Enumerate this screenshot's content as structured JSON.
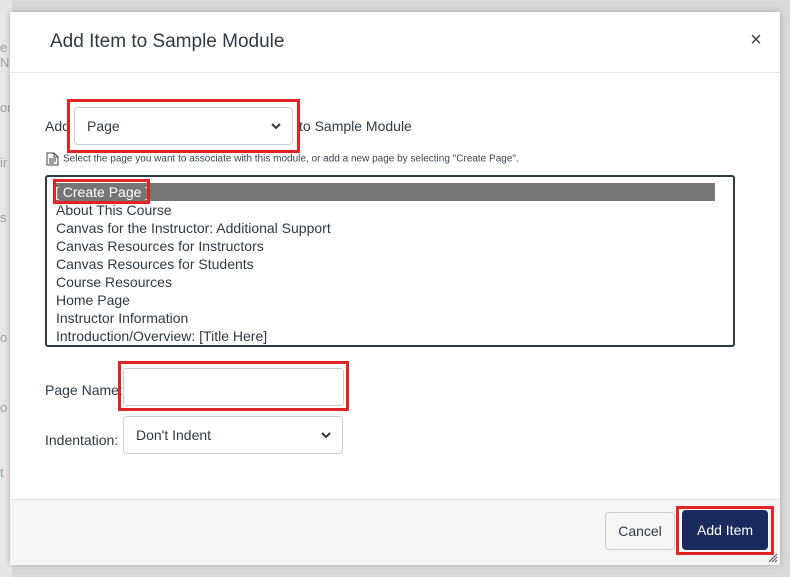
{
  "dialog": {
    "title": "Add Item to Sample Module",
    "close_label": "×"
  },
  "add_row": {
    "prefix": "Add",
    "type_select": {
      "selected": "Page"
    },
    "suffix": "to Sample Module"
  },
  "hint": "Select the page you want to associate with this module, or add a new page by selecting \"Create Page\".",
  "page_list": {
    "items": [
      "[ Create Page ]",
      "About This Course",
      "Canvas for the Instructor: Additional Support",
      "Canvas Resources for Instructors",
      "Canvas Resources for Students",
      "Course Resources",
      "Home Page",
      "Instructor Information",
      "Introduction/Overview: [Title Here]"
    ],
    "selected_index": 0
  },
  "page_name": {
    "label": "Page Name:",
    "value": ""
  },
  "indentation": {
    "label": "Indentation:",
    "selected": "Don't Indent"
  },
  "footer": {
    "cancel_label": "Cancel",
    "add_label": "Add Item"
  },
  "colors": {
    "highlight_border": "#e02424",
    "primary_button": "#1a2a5c",
    "selected_row": "#767676"
  }
}
